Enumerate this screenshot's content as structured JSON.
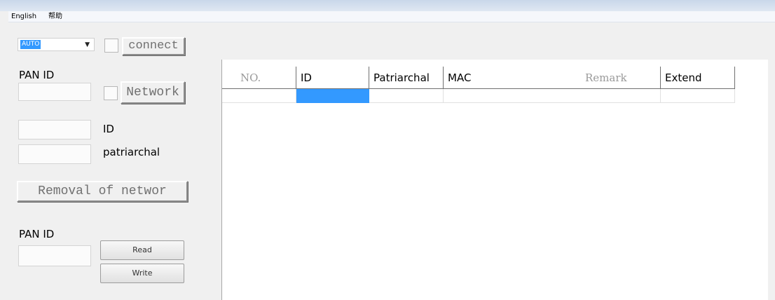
{
  "menu": [
    "English",
    "帮助"
  ],
  "connection": {
    "port_selected": "AUTO",
    "connect_label": "connect"
  },
  "network": {
    "pan_id_label": "PAN ID",
    "network_label": "Network",
    "id_label": "ID",
    "patriarchal_label": "patriarchal",
    "removal_label": "Removal of networ"
  },
  "pan": {
    "pan_id_label": "PAN ID",
    "read_label": "Read",
    "write_label": "Write"
  },
  "table": {
    "columns": [
      "NO.",
      "ID",
      "Patriarchal",
      "MAC",
      "Remark",
      "Extend"
    ],
    "selection_color": "#3399ff"
  }
}
